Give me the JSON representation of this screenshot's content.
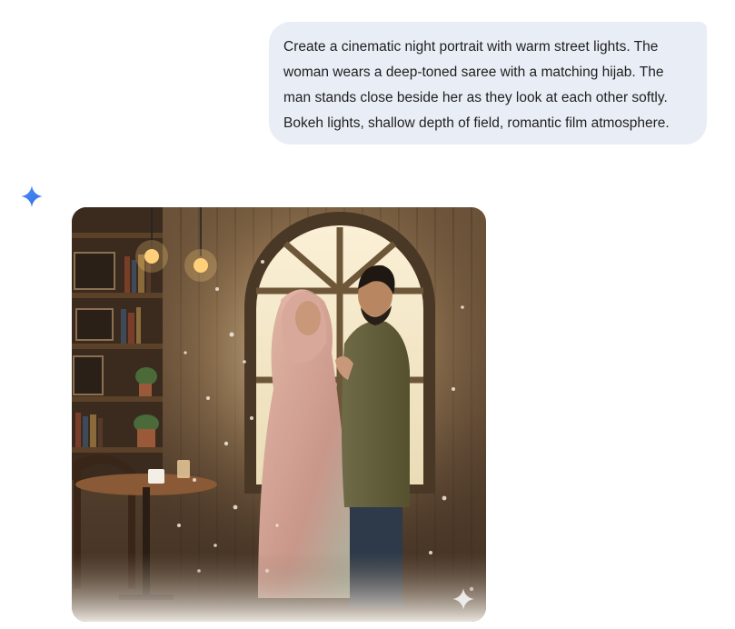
{
  "conversation": {
    "user_prompt": {
      "lines": [
        "Create a cinematic night portrait with warm street lights. The",
        "woman wears a deep-toned saree with a matching hijab. The",
        "man stands close beside her as they look at each other softly.",
        "Bokeh lights, shallow depth of field, romantic film atmosphere."
      ]
    },
    "response": {
      "avatar_icon": "gemini-spark-icon",
      "image_badge_icon": "sparkle-watermark-icon"
    }
  },
  "colors": {
    "bubble_bg": "#e9eef6",
    "text": "#1f1f1f",
    "gemini_blue": "#4285f4"
  }
}
